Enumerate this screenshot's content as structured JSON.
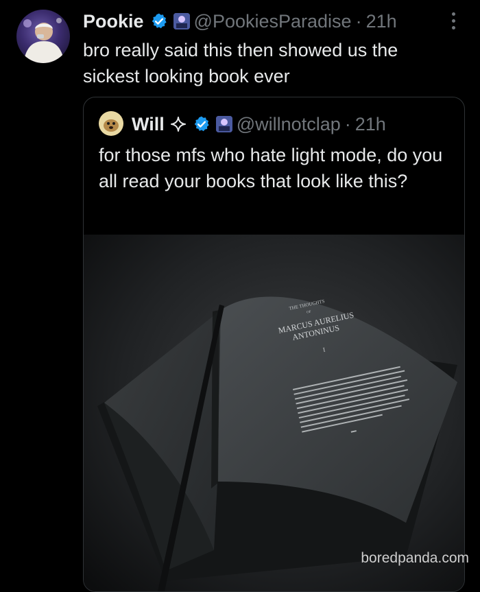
{
  "tweet": {
    "author_name": "Pookie",
    "handle": "@PookiesParadise",
    "separator": "·",
    "time": "21h",
    "text": "bro really said this then showed us the sickest looking book ever"
  },
  "quoted": {
    "author_name": "Will",
    "handle": "@willnotclap",
    "separator": "·",
    "time": "21h",
    "text": "for those mfs who hate light mode, do you all read your books that look like this?",
    "image": {
      "book_heading_small": "THE THOUGHTS",
      "book_heading_of": "OF",
      "book_title_line1": "MARCUS AURELIUS",
      "book_title_line2": "ANTONINUS",
      "book_chapter": "I"
    }
  },
  "watermark": "boredpanda.com",
  "icons": {
    "verified": "verified-badge-icon",
    "affiliate": "affiliate-badge-icon",
    "sparkle": "sparkle-icon",
    "more": "more-options-icon"
  },
  "colors": {
    "background": "#000000",
    "text": "#e7e9ea",
    "secondary": "#71767b",
    "verified": "#1d9bf0",
    "border": "#2f3336"
  }
}
